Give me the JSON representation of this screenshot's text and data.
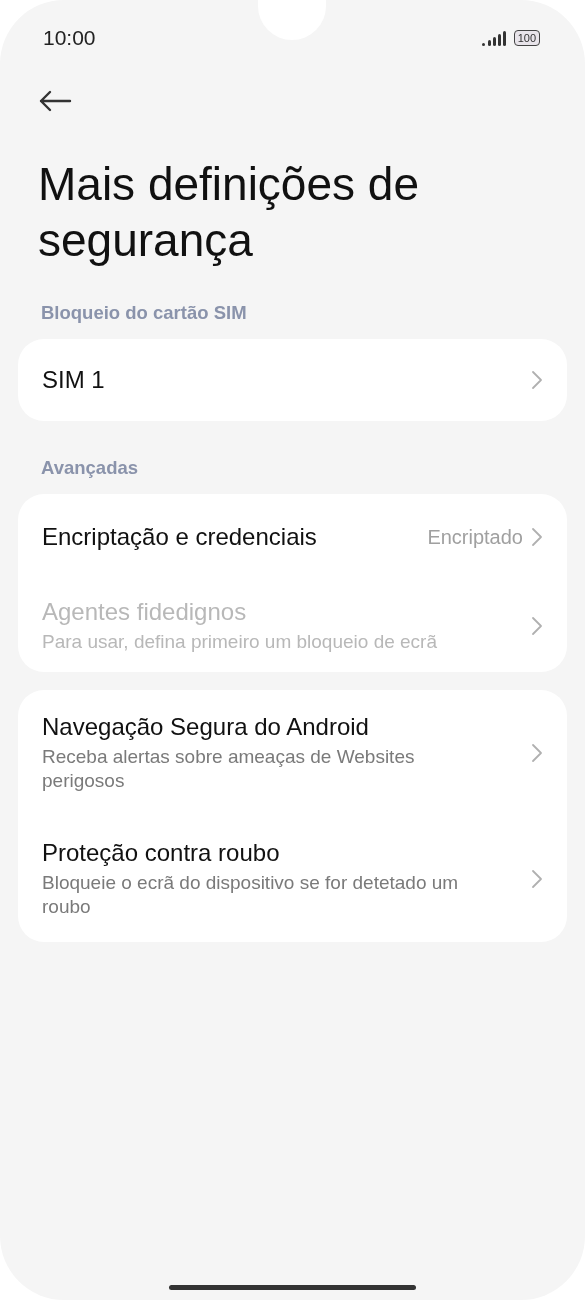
{
  "status_bar": {
    "time": "10:00",
    "battery": "100"
  },
  "title": "Mais definições de segurança",
  "groups": [
    {
      "header": "Bloqueio do cartão SIM",
      "items": [
        {
          "title": "SIM 1",
          "disabled": false
        }
      ]
    },
    {
      "header": "Avançadas",
      "items": [
        {
          "title": "Encriptação e credenciais",
          "value": "Encriptado",
          "disabled": false
        },
        {
          "title": "Agentes fidedignos",
          "subtitle": "Para usar, defina primeiro um bloqueio de ecrã",
          "disabled": true
        }
      ]
    },
    {
      "items": [
        {
          "title": "Navegação Segura do Android",
          "subtitle": "Receba alertas sobre ameaças de Websites perigosos",
          "disabled": false
        },
        {
          "title": "Proteção contra roubo",
          "subtitle": "Bloqueie o ecrã do dispositivo se for detetado um roubo",
          "disabled": false
        }
      ]
    }
  ]
}
